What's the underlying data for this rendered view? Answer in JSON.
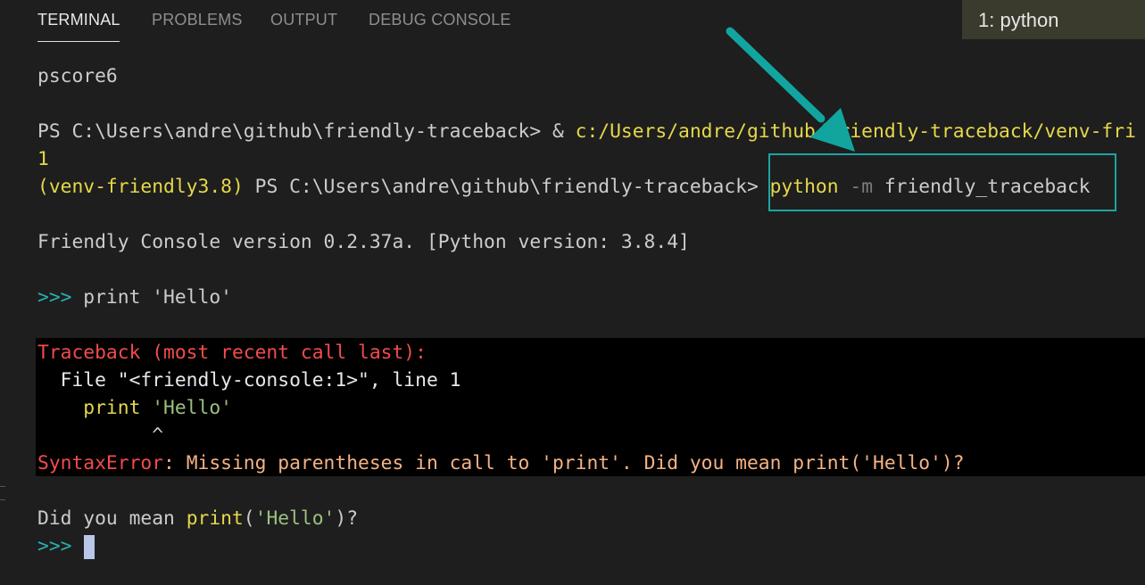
{
  "tabs": [
    "TERMINAL",
    "PROBLEMS",
    "OUTPUT",
    "DEBUG CONSOLE"
  ],
  "terminal_selector": "1: python",
  "colors": {
    "highlight_box": "#1fa3a3",
    "arrow": "#12a5a0"
  },
  "lines": {
    "l1": "pscore6",
    "l2_prompt": "PS C:\\Users\\andre\\github\\friendly-traceback> & ",
    "l2_path": "c:/Users/andre/github/friendly-traceback/venv-fri",
    "l3": "1",
    "l4_env": "(venv-friendly3.8)",
    "l4_ps": " PS C:\\Users\\andre\\github\\friendly-traceback> ",
    "l4_cmd": "python",
    "l4_flag": " -m",
    "l4_mod": " friendly_traceback",
    "l5": "Friendly Console version 0.2.37a. [Python version: 3.8.4]",
    "l6_prompt": ">>>",
    "l6_code": " print 'Hello'",
    "tb_header": "Traceback (most recent call last):",
    "tb_file": "  File \"<friendly-console:1>\", line 1",
    "tb_code_a": "    print ",
    "tb_code_b": "'Hello'",
    "tb_caret": "          ^",
    "err_type": "SyntaxError",
    "err_msg": ": Missing parentheses in call to 'print'. Did you mean print('Hello')?",
    "hint_a": "Did you mean ",
    "hint_b": "print",
    "hint_c": "(",
    "hint_d": "'Hello'",
    "hint_e": ")",
    "hint_f": "?",
    "final_prompt": ">>>"
  }
}
